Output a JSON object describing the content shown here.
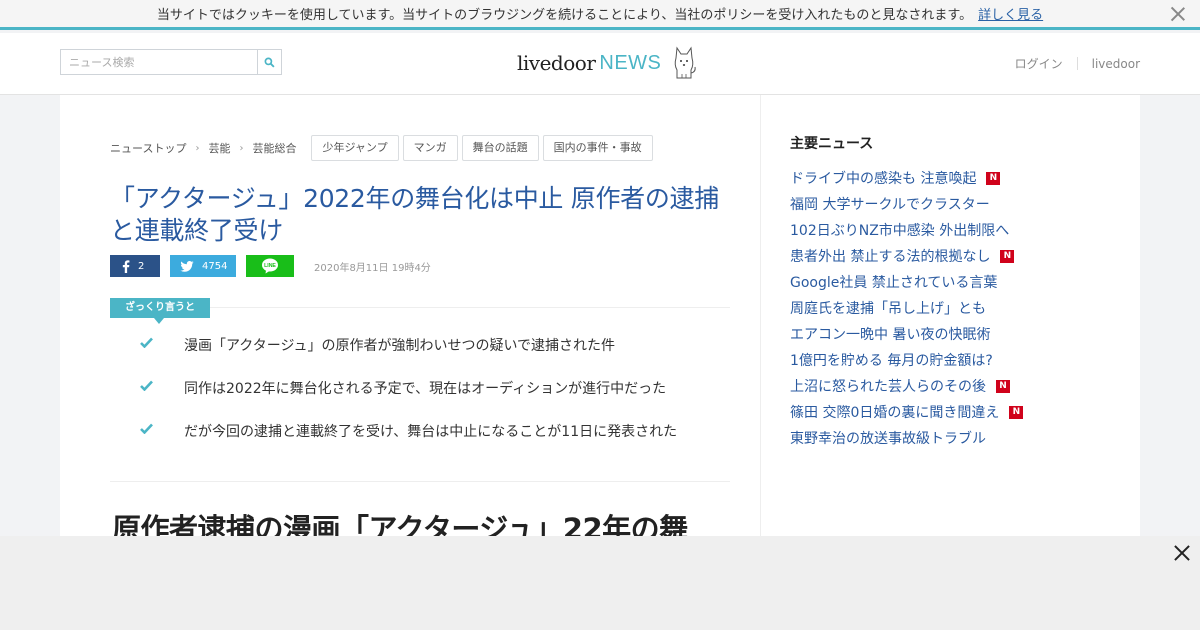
{
  "cookie": {
    "message": "当サイトではクッキーを使用しています。当サイトのブラウジングを続けることにより、当社のポリシーを受け入れたものと見なされます。",
    "more_link": "詳しく見る"
  },
  "header": {
    "search_placeholder": "ニュース検索",
    "logo_main": "livedoor",
    "logo_news": "NEWS",
    "login": "ログイン",
    "livedoor_link": "livedoor"
  },
  "breadcrumb": {
    "items": [
      "ニューストップ",
      "芸能",
      "芸能総合"
    ],
    "tags": [
      "少年ジャンプ",
      "マンガ",
      "舞台の話題",
      "国内の事件・事故"
    ]
  },
  "article": {
    "headline": "「アクタージュ」2022年の舞台化は中止 原作者の逮捕と連載終了受け",
    "share": {
      "facebook_count": "2",
      "twitter_count": "4754"
    },
    "date": "2020年8月11日 19時4分",
    "summary_label": "ざっくり言うと",
    "points": [
      "漫画「アクタージュ」の原作者が強制わいせつの疑いで逮捕された件",
      "同作は2022年に舞台化される予定で、現在はオーディションが進行中だった",
      "だが今回の逮捕と連載終了を受け、舞台は中止になることが11日に発表された"
    ],
    "subheading": "原作者逮捕の漫画「アクタージュ」22年の舞"
  },
  "sidebar": {
    "title": "主要ニュース",
    "new_badge": "N",
    "items": [
      {
        "text": "ドライブ中の感染も 注意喚起",
        "is_new": true
      },
      {
        "text": "福岡 大学サークルでクラスター",
        "is_new": false
      },
      {
        "text": "102日ぶりNZ市中感染 外出制限へ",
        "is_new": false
      },
      {
        "text": "患者外出 禁止する法的根拠なし",
        "is_new": true
      },
      {
        "text": "Google社員 禁止されている言葉",
        "is_new": false
      },
      {
        "text": "周庭氏を逮捕「吊し上げ」とも",
        "is_new": false
      },
      {
        "text": "エアコン一晩中 暑い夜の快眠術",
        "is_new": false
      },
      {
        "text": "1億円を貯める 毎月の貯金額は?",
        "is_new": false
      },
      {
        "text": "上沼に怒られた芸人らのその後",
        "is_new": true
      },
      {
        "text": "篠田 交際0日婚の裏に聞き間違え",
        "is_new": true
      },
      {
        "text": "東野幸治の放送事故級トラブル",
        "is_new": false
      }
    ]
  },
  "colors": {
    "accent": "#4bb5c6",
    "link": "#2a5aa0",
    "badge": "#d0021b",
    "facebook": "#2b5288",
    "twitter": "#3cabde",
    "line": "#19be19"
  }
}
